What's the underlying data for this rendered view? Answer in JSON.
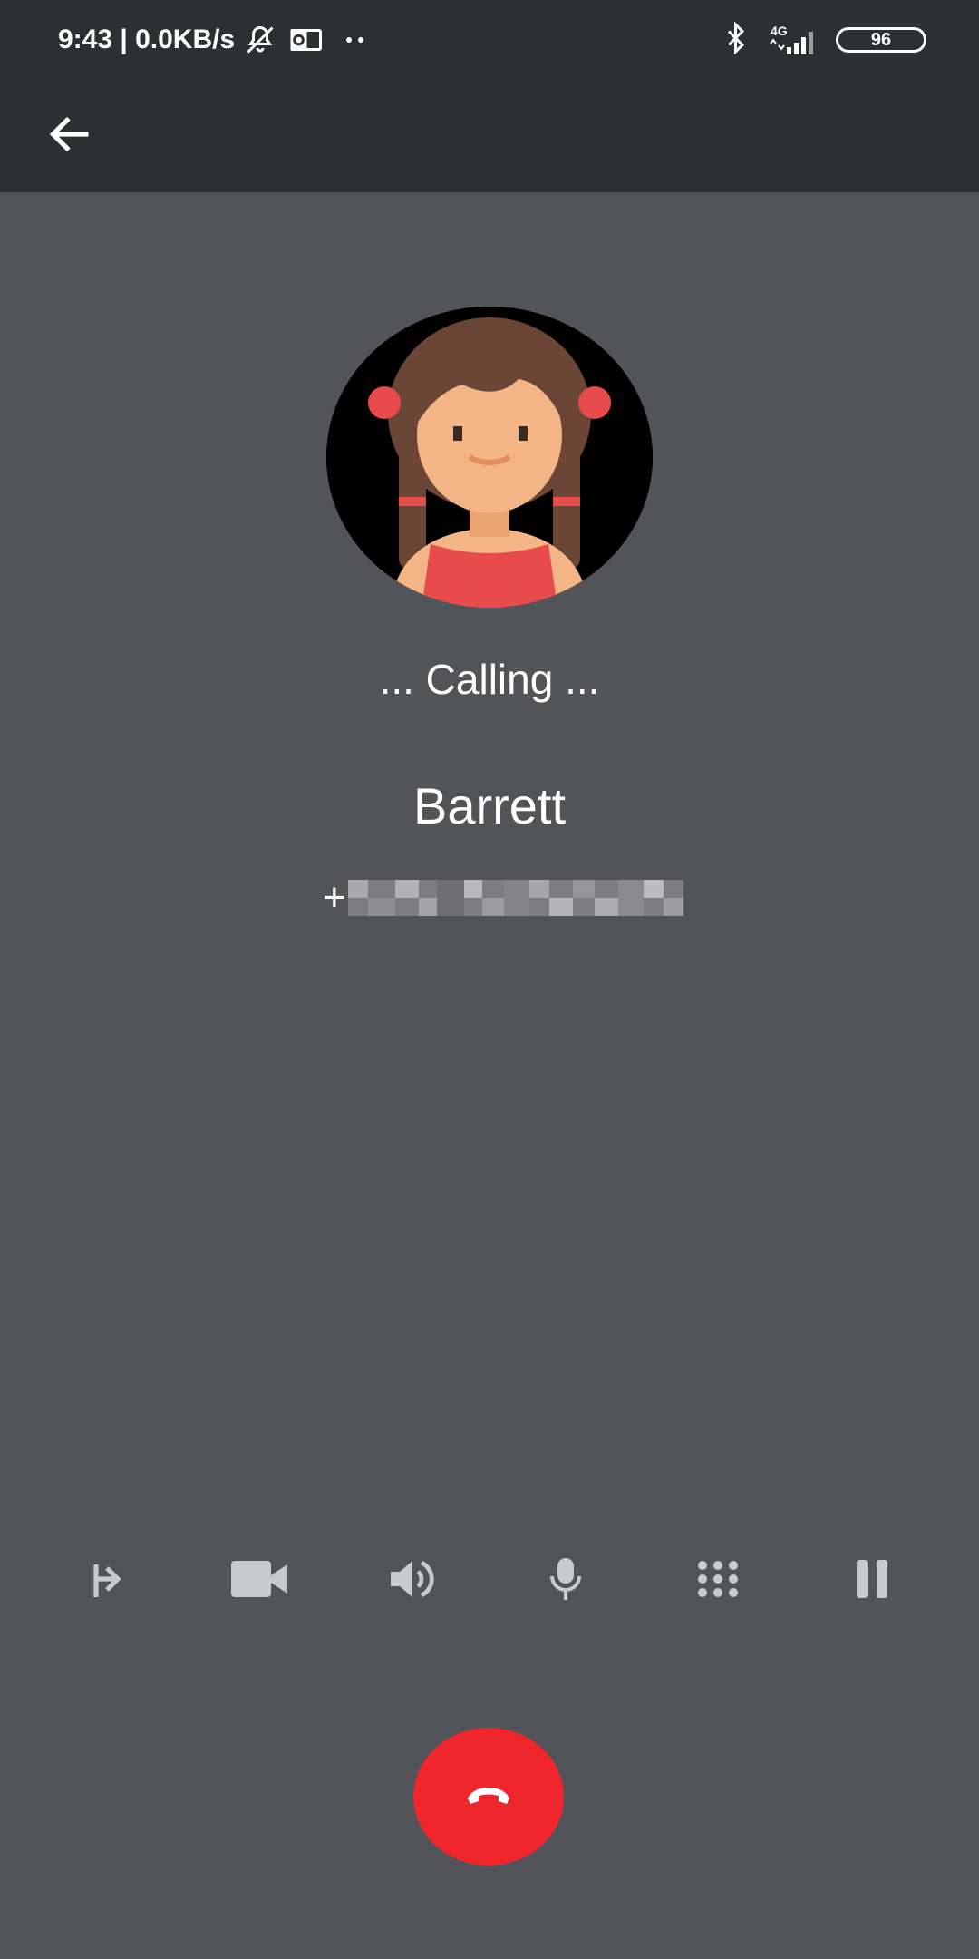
{
  "status_bar": {
    "time_speed": "9:43 | 0.0KB/s",
    "network": "4G",
    "battery": "96",
    "icons": [
      "mute-icon",
      "outlook-icon",
      "more-dots-icon",
      "bluetooth-icon",
      "signal-icon",
      "battery-icon"
    ]
  },
  "app_bar": {
    "back_icon": "back-arrow-icon"
  },
  "call": {
    "status": "... Calling ...",
    "contact_name": "Barrett",
    "number_prefix": "+"
  },
  "controls": [
    {
      "name": "transfer-button",
      "icon": "call-transfer-icon"
    },
    {
      "name": "video-button",
      "icon": "video-camera-icon"
    },
    {
      "name": "speaker-button",
      "icon": "speaker-icon"
    },
    {
      "name": "mute-mic-button",
      "icon": "microphone-icon"
    },
    {
      "name": "dialpad-button",
      "icon": "dialpad-icon"
    },
    {
      "name": "hold-button",
      "icon": "pause-icon"
    }
  ],
  "end_call": {
    "icon": "hang-up-icon"
  },
  "colors": {
    "status_bar_bg": "#2c3034",
    "screen_bg": "#535459",
    "end_call": "#f0262d",
    "icon_gray": "#c9cacd"
  }
}
